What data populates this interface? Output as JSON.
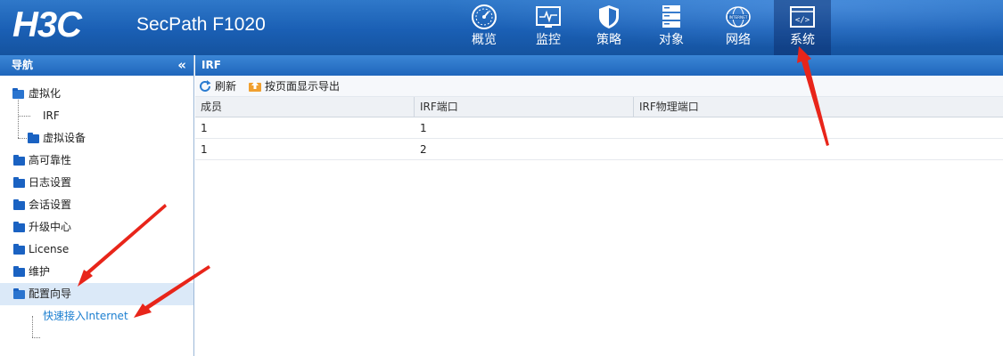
{
  "header": {
    "logo": "H3C",
    "product": "SecPath F1020",
    "nav": [
      {
        "label": "概览",
        "icon": "gauge-icon"
      },
      {
        "label": "监控",
        "icon": "monitor-icon"
      },
      {
        "label": "策略",
        "icon": "shield-icon"
      },
      {
        "label": "对象",
        "icon": "server-stack-icon"
      },
      {
        "label": "网络",
        "icon": "internet-globe-icon",
        "icon_text": "INTERNET"
      },
      {
        "label": "系统",
        "icon": "code-window-icon",
        "icon_text": "</>",
        "active": true
      }
    ]
  },
  "sidebar": {
    "title": "导航",
    "collapse_glyph": "«",
    "items": [
      {
        "label": "虚拟化",
        "expanded": true
      },
      {
        "label": "IRF"
      },
      {
        "label": "虚拟设备"
      },
      {
        "label": "高可靠性"
      },
      {
        "label": "日志设置"
      },
      {
        "label": "会话设置"
      },
      {
        "label": "升级中心"
      },
      {
        "label": "License"
      },
      {
        "label": "维护"
      },
      {
        "label": "配置向导",
        "expanded": true,
        "active": true
      },
      {
        "label": "快速接入Internet"
      }
    ]
  },
  "main": {
    "title": "IRF",
    "toolbar": {
      "refresh_label": "刷新",
      "export_label": "按页面显示导出"
    },
    "table": {
      "columns": [
        "成员",
        "IRF端口",
        "IRF物理端口"
      ],
      "rows": [
        [
          "1",
          "1",
          ""
        ],
        [
          "1",
          "2",
          ""
        ]
      ]
    }
  },
  "colors": {
    "header_blue": "#1a5fb4",
    "panel_head_blue": "#1f66bb",
    "folder_blue": "#1a62c2",
    "link_blue": "#1c7fd0",
    "arrow_red": "#e8251a",
    "active_row": "#dbe9f8"
  }
}
